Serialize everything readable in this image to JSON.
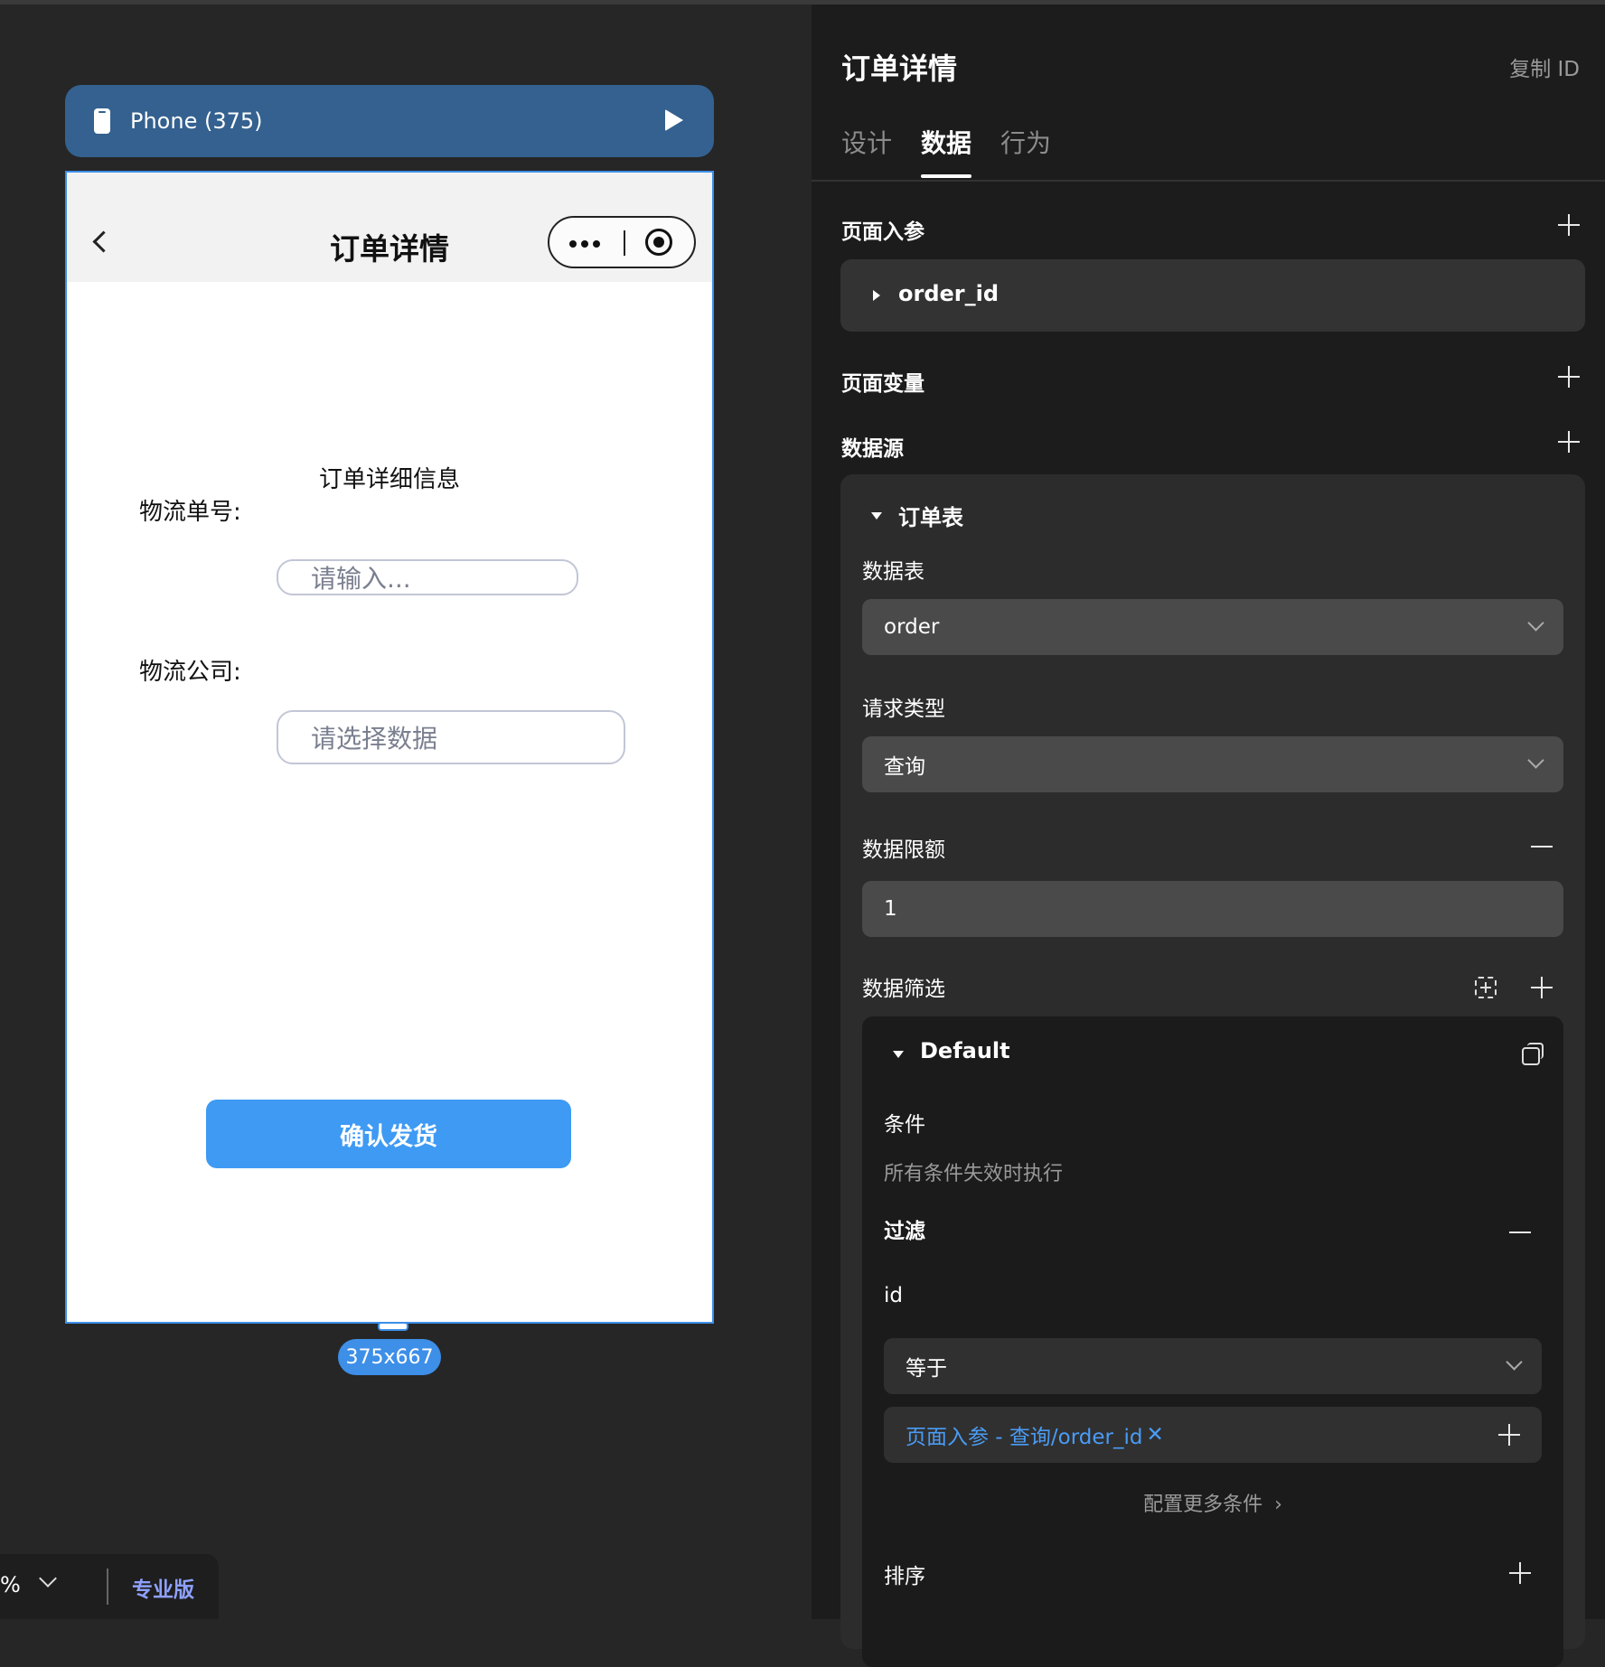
{
  "canvas": {
    "device_label": "Phone (375)",
    "size_badge": "375x667",
    "phone": {
      "nav_title": "订单详情",
      "subtitle": "订单详细信息",
      "fields": [
        {
          "label": "物流单号:",
          "placeholder": "请输入..."
        },
        {
          "label": "物流公司:",
          "placeholder": "请选择数据"
        }
      ],
      "confirm_button": "确认发货"
    }
  },
  "bottom_toolbar": {
    "zoom_suffix": "%",
    "edition": "专业版"
  },
  "panel": {
    "title": "订单详情",
    "copy_id": "复制 ID",
    "tabs": [
      {
        "label": "设计",
        "active": false
      },
      {
        "label": "数据",
        "active": true
      },
      {
        "label": "行为",
        "active": false
      }
    ],
    "page_params": {
      "title": "页面入参",
      "items": [
        {
          "name": "order_id"
        }
      ]
    },
    "page_vars": {
      "title": "页面变量"
    },
    "data_source": {
      "title": "数据源",
      "item": {
        "name": "订单表",
        "table_label": "数据表",
        "table_value": "order",
        "request_type_label": "请求类型",
        "request_type_value": "查询",
        "limit_label": "数据限额",
        "limit_value": "1",
        "filter_label": "数据筛选",
        "filter": {
          "name": "Default",
          "condition_label": "条件",
          "condition_hint": "所有条件失效时执行",
          "filter_label": "过滤",
          "field": "id",
          "operator": "等于",
          "value_tag": "页面入参 - 查询/order_id",
          "more_conditions": "配置更多条件",
          "sort_label": "排序"
        }
      }
    }
  },
  "colors": {
    "accent_blue": "#3e9af3",
    "device_bar": "#34618f",
    "panel_bg": "#1c1c1c",
    "canvas_bg": "#262626",
    "link_blue": "#4a9cf5",
    "pro_purple": "#8ea1ff"
  }
}
